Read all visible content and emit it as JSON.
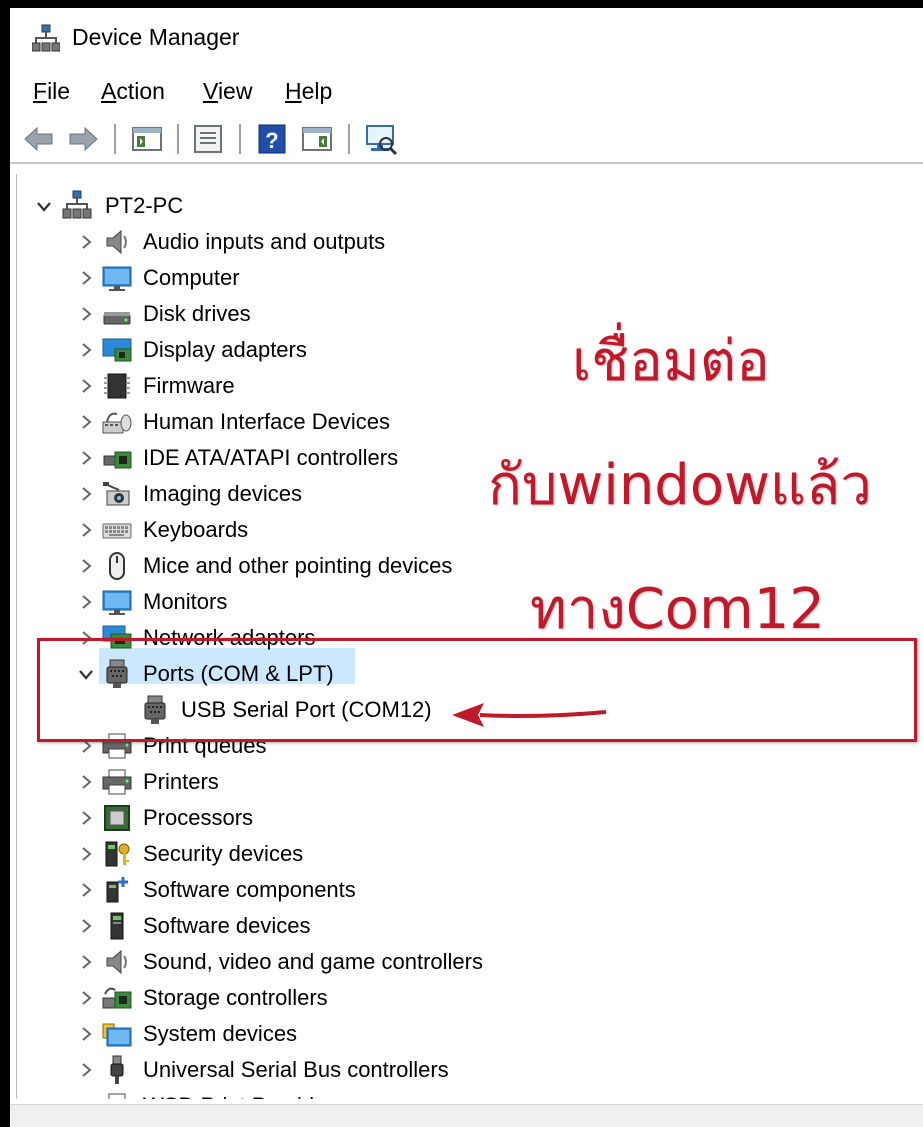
{
  "window": {
    "title": "Device Manager"
  },
  "menu": [
    {
      "key": "F",
      "rest": "ile"
    },
    {
      "key": "A",
      "rest": "ction"
    },
    {
      "key": "V",
      "rest": "iew"
    },
    {
      "key": "H",
      "rest": "elp"
    }
  ],
  "toolbar": {
    "icons": [
      "back-arrow-icon",
      "forward-arrow-icon",
      "show-hide-console-tree-icon",
      "properties-icon",
      "help-icon",
      "action-pane-icon",
      "scan-hardware-changes-icon"
    ]
  },
  "tree": {
    "root": "PT2-PC",
    "nodes": [
      {
        "label": "Audio inputs and outputs",
        "icon": "speaker-icon"
      },
      {
        "label": "Computer",
        "icon": "monitor-icon"
      },
      {
        "label": "Disk drives",
        "icon": "disk-drive-icon"
      },
      {
        "label": "Display adapters",
        "icon": "display-adapter-icon"
      },
      {
        "label": "Firmware",
        "icon": "firmware-chip-icon"
      },
      {
        "label": "Human Interface Devices",
        "icon": "hid-icon"
      },
      {
        "label": "IDE ATA/ATAPI controllers",
        "icon": "ide-controller-icon"
      },
      {
        "label": "Imaging devices",
        "icon": "camera-icon"
      },
      {
        "label": "Keyboards",
        "icon": "keyboard-icon"
      },
      {
        "label": "Mice and other pointing devices",
        "icon": "mouse-icon"
      },
      {
        "label": "Monitors",
        "icon": "monitor-icon"
      },
      {
        "label": "Network adapters",
        "icon": "network-adapter-icon"
      },
      {
        "label": "Ports (COM & LPT)",
        "icon": "port-icon",
        "expanded": true
      },
      {
        "label": "USB Serial Port (COM12)",
        "icon": "port-icon",
        "child": true
      },
      {
        "label": "Print queues",
        "icon": "printer-icon"
      },
      {
        "label": "Printers",
        "icon": "printer-icon"
      },
      {
        "label": "Processors",
        "icon": "processor-icon"
      },
      {
        "label": "Security devices",
        "icon": "security-device-icon"
      },
      {
        "label": "Software components",
        "icon": "software-component-icon"
      },
      {
        "label": "Software devices",
        "icon": "software-device-icon"
      },
      {
        "label": "Sound, video and game controllers",
        "icon": "speaker-icon"
      },
      {
        "label": "Storage controllers",
        "icon": "storage-controller-icon"
      },
      {
        "label": "System devices",
        "icon": "system-devices-icon"
      },
      {
        "label": "Universal Serial Bus controllers",
        "icon": "usb-icon"
      },
      {
        "label": "WSD Print Provider",
        "icon": "printer-icon"
      }
    ]
  },
  "annotation": {
    "line1": "เชื่อมต่อ",
    "line2": "กับwindowแล้ว",
    "line3": "ทางCom12",
    "color": "#c0192b"
  },
  "colors": {
    "selection": "#cce8ff",
    "annotation_red": "#c0192b"
  }
}
